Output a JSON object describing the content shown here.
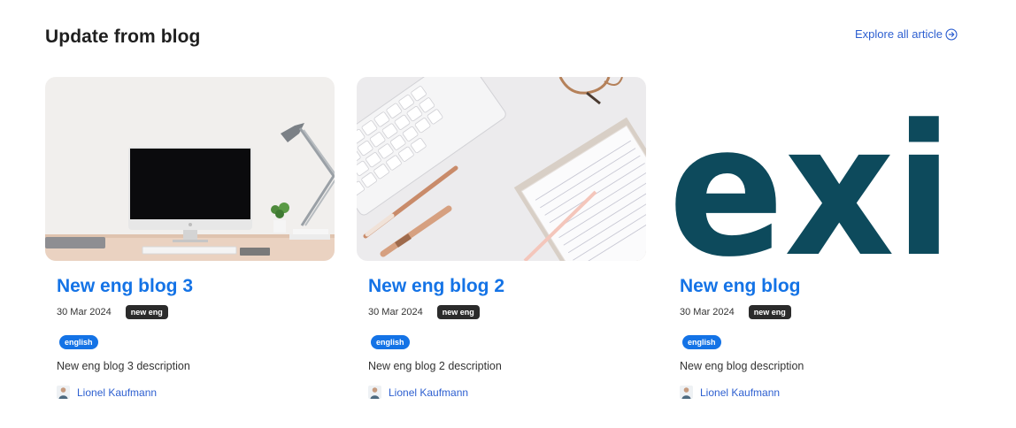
{
  "section": {
    "title": "Update from blog",
    "explore_link": "Explore all article"
  },
  "posts": [
    {
      "title": "New eng blog 3",
      "date": "30 Mar 2024",
      "category": "new eng",
      "tag": "english",
      "description": "New eng blog 3 description",
      "author": "Lionel Kaufmann",
      "image_icon": "desk-computer-photo"
    },
    {
      "title": "New eng blog 2",
      "date": "30 Mar 2024",
      "category": "new eng",
      "tag": "english",
      "description": "New eng blog 2 description",
      "author": "Lionel Kaufmann",
      "image_icon": "keyboard-pens-photo"
    },
    {
      "title": "New eng blog",
      "date": "30 Mar 2024",
      "category": "new eng",
      "tag": "english",
      "description": "New eng blog description",
      "author": "Lionel Kaufmann",
      "image_icon": "exi-logo",
      "image_text": "exi"
    }
  ],
  "colors": {
    "accent": "#1473e6",
    "link": "#2d5fd0",
    "exi_logo": "#0d4a5c"
  }
}
